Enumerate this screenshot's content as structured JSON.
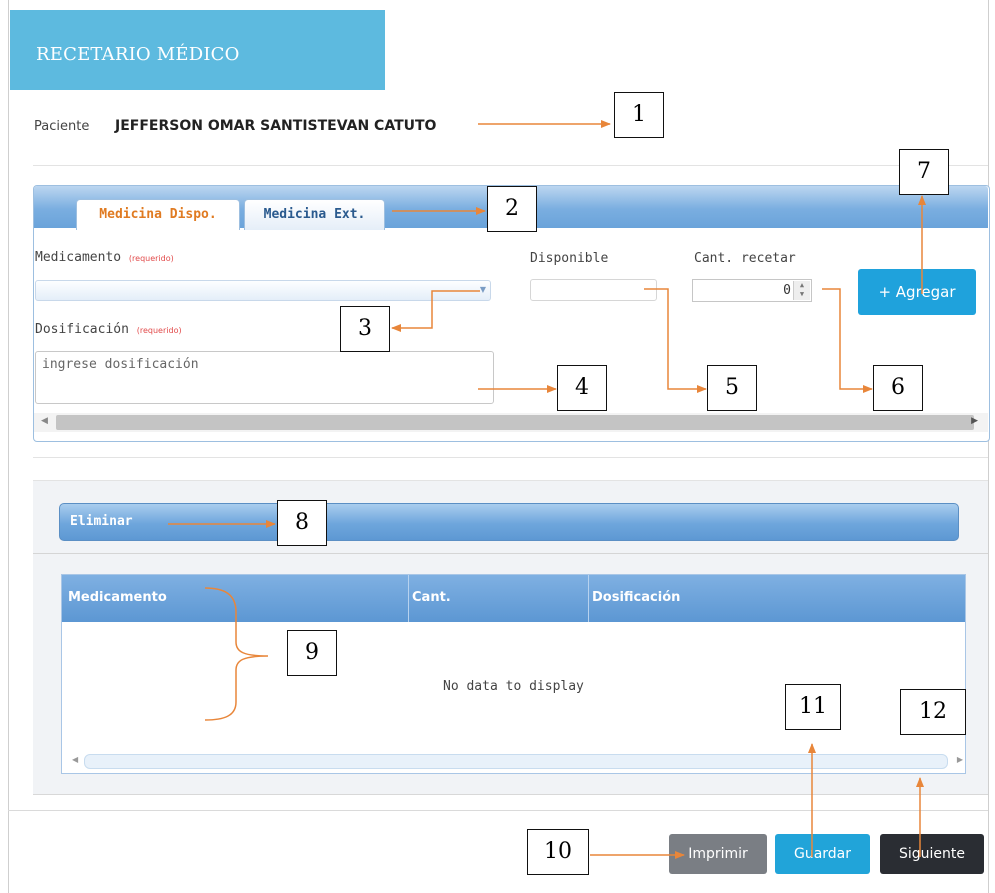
{
  "header": {
    "title": "RECETARIO MÉDICO"
  },
  "patient": {
    "label": "Paciente",
    "name": "JEFFERSON OMAR SANTISTEVAN CATUTO"
  },
  "tabs": [
    {
      "label": "Medicina Dispo.",
      "active": true
    },
    {
      "label": "Medicina Ext.",
      "active": false
    }
  ],
  "form": {
    "medicamento_label": "Medicamento",
    "required_text": "(requerido)",
    "medicamento_value": "",
    "disponible_label": "Disponible",
    "disponible_value": "",
    "cantidad_label": "Cant. recetar",
    "cantidad_value": "0",
    "dosificacion_label": "Dosificación",
    "dosificacion_placeholder": "ingrese dosificación",
    "add_label": "+ Agregar"
  },
  "list_toolbar": {
    "delete_label": "Eliminar"
  },
  "grid": {
    "columns": [
      "Medicamento",
      "Cant.",
      "Dosificación"
    ],
    "empty_text": "No data to display"
  },
  "footer": {
    "print_label": "Imprimir",
    "save_label": "Guardar",
    "next_label": "Siguiente"
  },
  "callouts": [
    "1",
    "2",
    "3",
    "4",
    "5",
    "6",
    "7",
    "8",
    "9",
    "10",
    "11",
    "12"
  ],
  "colors": {
    "title_bg": "#5dbadf",
    "accent": "#1fa2dc",
    "tab_active": "#e07b22",
    "annotation": "#e8863a"
  }
}
